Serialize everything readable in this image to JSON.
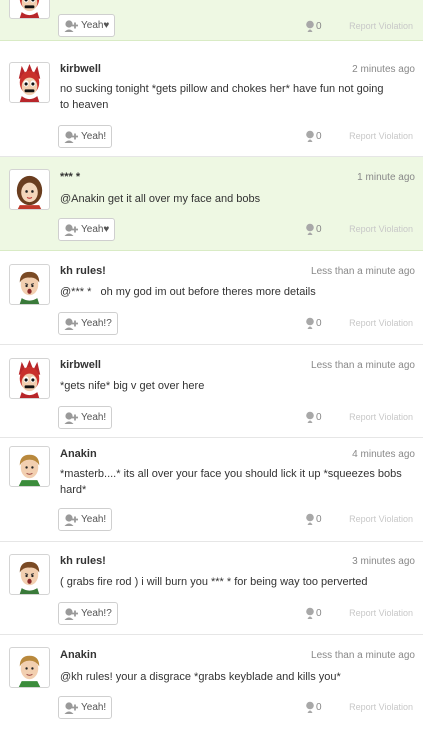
{
  "colors": {
    "highlight_bg": "#eef8e3",
    "text": "#333333",
    "muted": "#888888",
    "report": "#c8c8c8"
  },
  "icons": {
    "yeah": "yeah-mii-plus-icon",
    "empathy": "mii-head-icon",
    "dropdown": "down-triangle-icon"
  },
  "posts": [
    {
      "author": "",
      "time": "",
      "body": "",
      "yeah_label": "Yeah♥",
      "empathy_count": "0",
      "report_label": "Report Violation",
      "avatar": "kirbwell-mii",
      "highlighted": true
    },
    {
      "author": "kirbwell",
      "time": "2 minutes ago",
      "body": "no sucking tonight *gets pillow and chokes her* have fun not going to heaven",
      "yeah_label": "Yeah!",
      "empathy_count": "0",
      "report_label": "Report Violation",
      "avatar": "kirbwell-mii",
      "highlighted": false
    },
    {
      "author": "*** *",
      "time": "1 minute ago",
      "body": "@Anakin get it all over my face and bobs",
      "yeah_label": "Yeah♥",
      "empathy_count": "0",
      "report_label": "Report Violation",
      "avatar": "brown-hair-female-mii",
      "highlighted": true
    },
    {
      "author": "kh rules!",
      "time": "Less than a minute ago",
      "body": "@*** *   oh my god im out before theres more details",
      "yeah_label": "Yeah!?",
      "empathy_count": "0",
      "report_label": "Report Violation",
      "avatar": "kh-rules-mii",
      "highlighted": false
    },
    {
      "author": "kirbwell",
      "time": "Less than a minute ago",
      "body": "*gets nife* big v get over here",
      "yeah_label": "Yeah!",
      "empathy_count": "0",
      "report_label": "Report Violation",
      "avatar": "kirbwell-mii",
      "highlighted": false
    },
    {
      "author": "Anakin",
      "time": "4 minutes ago",
      "body": "*masterb....* its all over your face you should lick it up *squeezes bobs hard*",
      "yeah_label": "Yeah!",
      "empathy_count": "0",
      "report_label": "Report Violation",
      "avatar": "anakin-mii",
      "highlighted": false
    },
    {
      "author": "kh rules!",
      "time": "3 minutes ago",
      "body": "( grabs fire rod ) i will burn you *** * for being way too perverted",
      "yeah_label": "Yeah!?",
      "empathy_count": "0",
      "report_label": "Report Violation",
      "avatar": "kh-rules-mii",
      "highlighted": false
    },
    {
      "author": "Anakin",
      "time": "Less than a minute ago",
      "body": "@kh rules! your a disgrace *grabs keyblade and kills you*",
      "yeah_label": "Yeah!",
      "empathy_count": "0",
      "report_label": "Report Violation",
      "avatar": "anakin-mii",
      "highlighted": false
    }
  ]
}
